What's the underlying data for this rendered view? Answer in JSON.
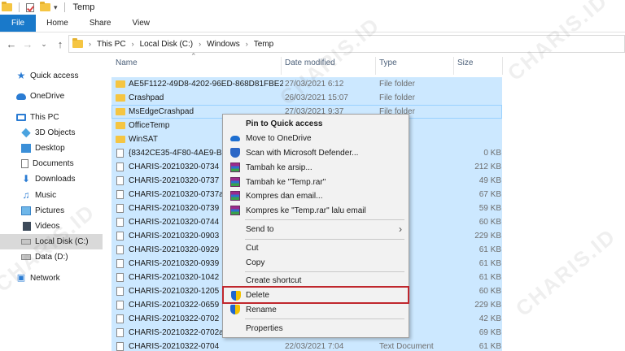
{
  "window": {
    "title": "Temp"
  },
  "ribbon": {
    "tabs": [
      "File",
      "Home",
      "Share",
      "View"
    ]
  },
  "address": {
    "crumbs": [
      "This PC",
      "Local Disk (C:)",
      "Windows",
      "Temp"
    ]
  },
  "sidebar": {
    "items": [
      {
        "label": "Quick access",
        "icon": "star-icon"
      },
      {
        "label": "OneDrive",
        "icon": "cloud-icon"
      },
      {
        "label": "This PC",
        "icon": "pc-icon"
      },
      {
        "label": "3D Objects",
        "icon": "cube-icon"
      },
      {
        "label": "Desktop",
        "icon": "desktop-icon"
      },
      {
        "label": "Documents",
        "icon": "document-icon"
      },
      {
        "label": "Downloads",
        "icon": "download-icon"
      },
      {
        "label": "Music",
        "icon": "music-icon"
      },
      {
        "label": "Pictures",
        "icon": "picture-icon"
      },
      {
        "label": "Videos",
        "icon": "video-icon"
      },
      {
        "label": "Local Disk (C:)",
        "icon": "disk-icon",
        "selected": true
      },
      {
        "label": "Data (D:)",
        "icon": "disk-icon"
      },
      {
        "label": "Network",
        "icon": "network-icon"
      }
    ]
  },
  "filelist": {
    "headers": {
      "name": "Name",
      "date": "Date modified",
      "type": "Type",
      "size": "Size"
    },
    "rows": [
      {
        "name": "AE5F1122-49D8-4202-96ED-868D81FBE27...",
        "date": "27/03/2021 6:12",
        "type": "File folder",
        "size": "",
        "kind": "folder"
      },
      {
        "name": "Crashpad",
        "date": "26/03/2021 15:07",
        "type": "File folder",
        "size": "",
        "kind": "folder"
      },
      {
        "name": "MsEdgeCrashpad",
        "date": "27/03/2021 9:37",
        "type": "File folder",
        "size": "",
        "kind": "folder"
      },
      {
        "name": "OfficeTemp",
        "date": "",
        "type": "",
        "size": "",
        "kind": "folder"
      },
      {
        "name": "WinSAT",
        "date": "",
        "type": "",
        "size": "",
        "kind": "folder"
      },
      {
        "name": "{8342CE35-4F80-4AE9-B799",
        "date": "",
        "type": "",
        "size": "0 KB",
        "kind": "file"
      },
      {
        "name": "CHARIS-20210320-0734",
        "date": "",
        "type": "ument",
        "size": "212 KB",
        "kind": "file"
      },
      {
        "name": "CHARIS-20210320-0737",
        "date": "",
        "type": "ument",
        "size": "49 KB",
        "kind": "file"
      },
      {
        "name": "CHARIS-20210320-0737a",
        "date": "",
        "type": "ument",
        "size": "67 KB",
        "kind": "file"
      },
      {
        "name": "CHARIS-20210320-0739",
        "date": "",
        "type": "ument",
        "size": "59 KB",
        "kind": "file"
      },
      {
        "name": "CHARIS-20210320-0744",
        "date": "",
        "type": "ument",
        "size": "60 KB",
        "kind": "file"
      },
      {
        "name": "CHARIS-20210320-0903",
        "date": "",
        "type": "ument",
        "size": "229 KB",
        "kind": "file"
      },
      {
        "name": "CHARIS-20210320-0929",
        "date": "",
        "type": "ument",
        "size": "61 KB",
        "kind": "file"
      },
      {
        "name": "CHARIS-20210320-0939",
        "date": "",
        "type": "ument",
        "size": "61 KB",
        "kind": "file"
      },
      {
        "name": "CHARIS-20210320-1042",
        "date": "",
        "type": "ument",
        "size": "61 KB",
        "kind": "file"
      },
      {
        "name": "CHARIS-20210320-1205",
        "date": "",
        "type": "ument",
        "size": "60 KB",
        "kind": "file"
      },
      {
        "name": "CHARIS-20210322-0659",
        "date": "",
        "type": "ument",
        "size": "229 KB",
        "kind": "file"
      },
      {
        "name": "CHARIS-20210322-0702",
        "date": "",
        "type": "ument",
        "size": "42 KB",
        "kind": "file"
      },
      {
        "name": "CHARIS-20210322-0702a",
        "date": "",
        "type": "ument",
        "size": "69 KB",
        "kind": "file"
      },
      {
        "name": "CHARIS-20210322-0704",
        "date": "22/03/2021 7:04",
        "type": "Text Document",
        "size": "61 KB",
        "kind": "file"
      }
    ]
  },
  "context_menu": {
    "items": [
      {
        "label": "Pin to Quick access",
        "bold": true,
        "icon": ""
      },
      {
        "label": "Move to OneDrive",
        "icon": "onedrive-icon"
      },
      {
        "label": "Scan with Microsoft Defender...",
        "icon": "defender-icon"
      },
      {
        "label": "Tambah ke arsip...",
        "icon": "rar-icon"
      },
      {
        "label": "Tambah ke \"Temp.rar\"",
        "icon": "rar-icon"
      },
      {
        "label": "Kompres dan email...",
        "icon": "rar-icon"
      },
      {
        "label": "Kompres ke \"Temp.rar\" lalu email",
        "icon": "rar-icon"
      },
      {
        "label": "Send to",
        "icon": "",
        "submenu": true
      },
      {
        "label": "Cut",
        "icon": ""
      },
      {
        "label": "Copy",
        "icon": ""
      },
      {
        "label": "Create shortcut",
        "icon": ""
      },
      {
        "label": "Delete",
        "icon": "shield-icon",
        "highlight": true
      },
      {
        "label": "Rename",
        "icon": "shield-icon"
      },
      {
        "label": "Properties",
        "icon": ""
      }
    ]
  },
  "watermark": "CHARIS.ID",
  "colors": {
    "accent": "#1979ca",
    "selection": "#cce8ff",
    "highlight_border": "#c0272d"
  }
}
